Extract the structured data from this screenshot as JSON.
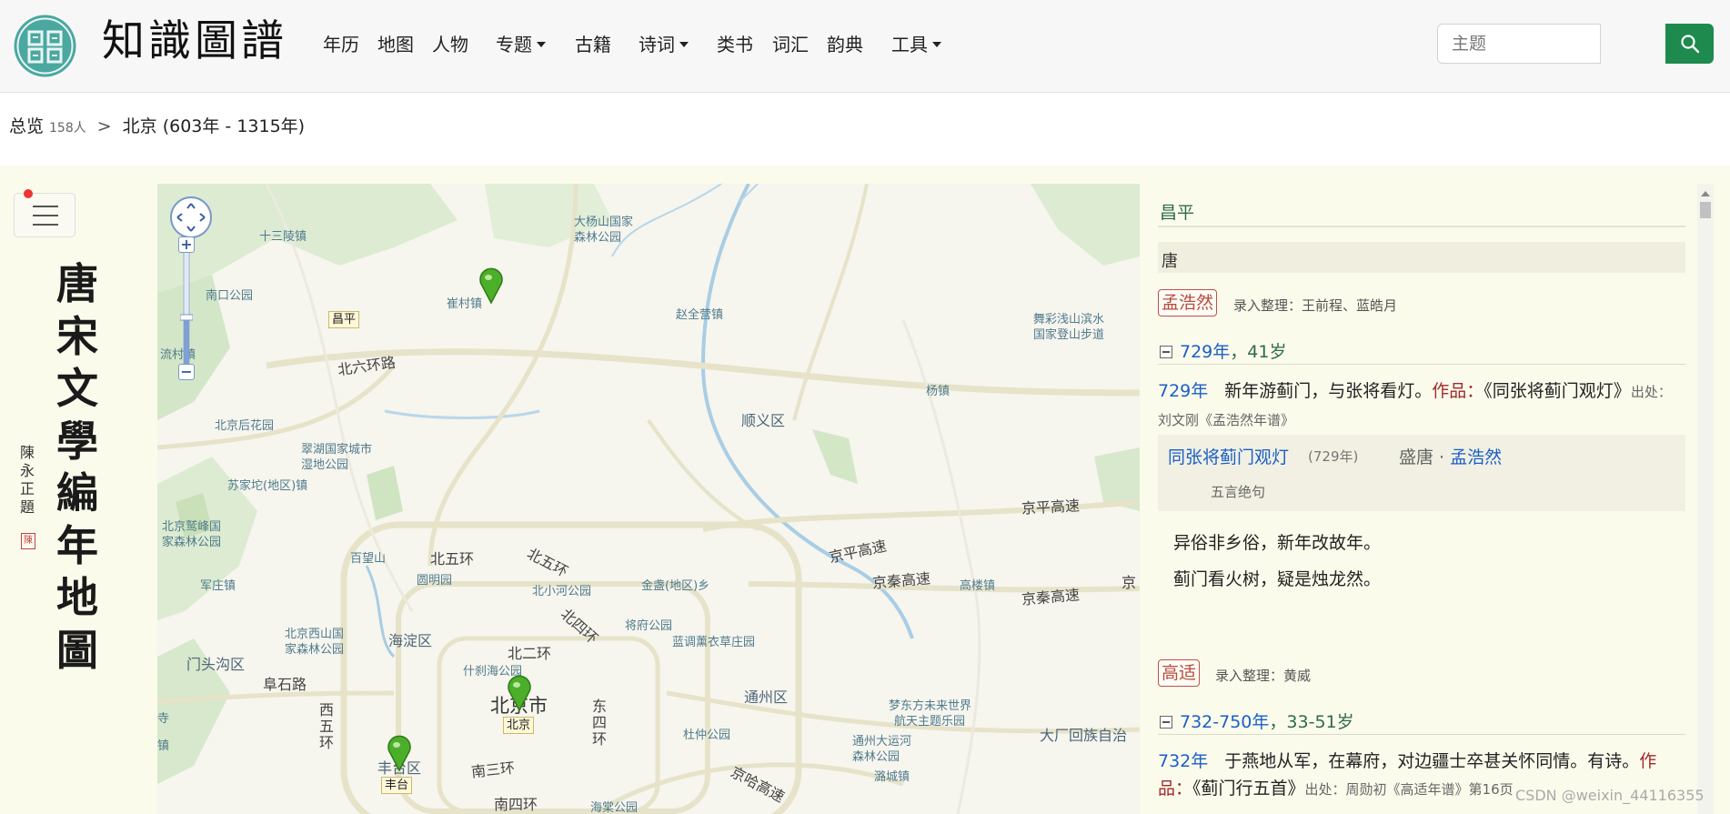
{
  "header": {
    "logo_title": "知識圖譜",
    "seal_text": "圖譜",
    "nav": [
      {
        "label": "年历",
        "dropdown": false
      },
      {
        "label": "地图",
        "dropdown": false
      },
      {
        "label": "人物",
        "dropdown": false
      },
      {
        "label": "专题",
        "dropdown": true
      },
      {
        "label": "古籍",
        "dropdown": false
      },
      {
        "label": "诗词",
        "dropdown": true
      },
      {
        "label": "类书",
        "dropdown": false
      },
      {
        "label": "词汇",
        "dropdown": false
      },
      {
        "label": "韵典",
        "dropdown": false
      },
      {
        "label": "工具",
        "dropdown": true
      }
    ],
    "search": {
      "placeholder": "主题",
      "value": ""
    },
    "accent_color": "#1e8a4e"
  },
  "breadcrumb": {
    "root": "总览",
    "count": "158人",
    "separator": ">",
    "current": "北京 (603年 - 1315年)"
  },
  "sidebar": {
    "title_vertical": "唐宋文學編年地圖",
    "inscription": "陳永正題",
    "seal": "陳"
  },
  "map": {
    "labels": [
      {
        "text": "十三陵镇",
        "kind": "park"
      },
      {
        "text": "大杨山国家",
        "kind": "park"
      },
      {
        "text": "森林公园",
        "kind": "park"
      },
      {
        "text": "南口公园",
        "kind": "park"
      },
      {
        "text": "崔村镇",
        "kind": "park"
      },
      {
        "text": "赵全营镇",
        "kind": "park"
      },
      {
        "text": "舞彩浅山滨水",
        "kind": "park"
      },
      {
        "text": "国家登山步道",
        "kind": "park"
      },
      {
        "text": "流村镇",
        "kind": "park"
      },
      {
        "text": "北六环路",
        "kind": "road"
      },
      {
        "text": "杨镇",
        "kind": "park"
      },
      {
        "text": "北京后花园",
        "kind": "park"
      },
      {
        "text": "顺义区",
        "kind": "district"
      },
      {
        "text": "翠湖国家城市",
        "kind": "park"
      },
      {
        "text": "湿地公园",
        "kind": "park"
      },
      {
        "text": "苏家坨(地区)镇",
        "kind": "park"
      },
      {
        "text": "京平高速",
        "kind": "road"
      },
      {
        "text": "北京鹫峰国",
        "kind": "park"
      },
      {
        "text": "家森林公园",
        "kind": "park"
      },
      {
        "text": "百望山",
        "kind": "park"
      },
      {
        "text": "北五环",
        "kind": "road"
      },
      {
        "text": "北五环",
        "kind": "road"
      },
      {
        "text": "京平高速",
        "kind": "road"
      },
      {
        "text": "圆明园",
        "kind": "park"
      },
      {
        "text": "北小河公园",
        "kind": "park"
      },
      {
        "text": "金盏(地区)乡",
        "kind": "park"
      },
      {
        "text": "京秦高速",
        "kind": "road"
      },
      {
        "text": "高楼镇",
        "kind": "park"
      },
      {
        "text": "京秦高速",
        "kind": "road"
      },
      {
        "text": "军庄镇",
        "kind": "park"
      },
      {
        "text": "北四环",
        "kind": "road"
      },
      {
        "text": "将府公园",
        "kind": "park"
      },
      {
        "text": "北京西山国",
        "kind": "park"
      },
      {
        "text": "家森林公园",
        "kind": "park"
      },
      {
        "text": "海淀区",
        "kind": "district"
      },
      {
        "text": "北二环",
        "kind": "road"
      },
      {
        "text": "蓝调薰衣草庄园",
        "kind": "park"
      },
      {
        "text": "门头沟区",
        "kind": "district"
      },
      {
        "text": "什刹海公园",
        "kind": "park"
      },
      {
        "text": "阜石路",
        "kind": "road"
      },
      {
        "text": "北京市",
        "kind": "city"
      },
      {
        "text": "通州区",
        "kind": "district"
      },
      {
        "text": "梦东方未来世界",
        "kind": "park"
      },
      {
        "text": "航天主题乐园",
        "kind": "park"
      },
      {
        "text": "西",
        "kind": "road"
      },
      {
        "text": "五",
        "kind": "road"
      },
      {
        "text": "环",
        "kind": "road"
      },
      {
        "text": "东",
        "kind": "road"
      },
      {
        "text": "四",
        "kind": "road"
      },
      {
        "text": "环",
        "kind": "road"
      },
      {
        "text": "杜仲公园",
        "kind": "park"
      },
      {
        "text": "大厂回族自治",
        "kind": "district"
      },
      {
        "text": "通州大运河",
        "kind": "park"
      },
      {
        "text": "森林公园",
        "kind": "park"
      },
      {
        "text": "丰台区",
        "kind": "district"
      },
      {
        "text": "南三环",
        "kind": "road"
      },
      {
        "text": "京哈高速",
        "kind": "road"
      },
      {
        "text": "潞城镇",
        "kind": "park"
      },
      {
        "text": "南四环",
        "kind": "road"
      },
      {
        "text": "海棠公园",
        "kind": "park"
      },
      {
        "text": "寺",
        "kind": "park"
      },
      {
        "text": "镇",
        "kind": "park"
      },
      {
        "text": "京",
        "kind": "road"
      }
    ],
    "markers": [
      {
        "label": "昌平"
      },
      {
        "label": "北京"
      },
      {
        "label": "丰台"
      }
    ],
    "controls": {
      "zoom_in": "+",
      "zoom_out": "−"
    }
  },
  "panel": {
    "place": "昌平",
    "dynasty": "唐",
    "poets": [
      {
        "name": "孟浩然",
        "editors": "录入整理：王前程、蓝皓月",
        "year_range": "729年",
        "age": "41岁",
        "entry_year": "729年",
        "entry_text": "新年游蓟门，与张将看灯。",
        "works_label": "作品：",
        "works": "《同张将蓟门观灯》",
        "source": "出处：刘文刚《孟浩然年谱》",
        "poem": {
          "title": "同张将蓟门观灯",
          "year": "(729年)",
          "era": "盛唐 · ",
          "author": "孟浩然",
          "form": "五言绝句",
          "lines": [
            "异俗非乡俗，新年改故年。",
            "蓟门看火树，疑是烛龙然。"
          ]
        }
      },
      {
        "name": "高适",
        "editors": "录入整理：黄威",
        "year_range": "732-750年",
        "age": "33-51岁",
        "entry_year": "732年",
        "entry_text": "于燕地从军，在幕府，对边疆士卒甚关怀同情。有诗。",
        "works_label": "作品：",
        "works": "《蓟门行五首》",
        "source": "出处：周勋初《高适年谱》第16页"
      }
    ]
  },
  "watermark": "CSDN @weixin_44116355"
}
